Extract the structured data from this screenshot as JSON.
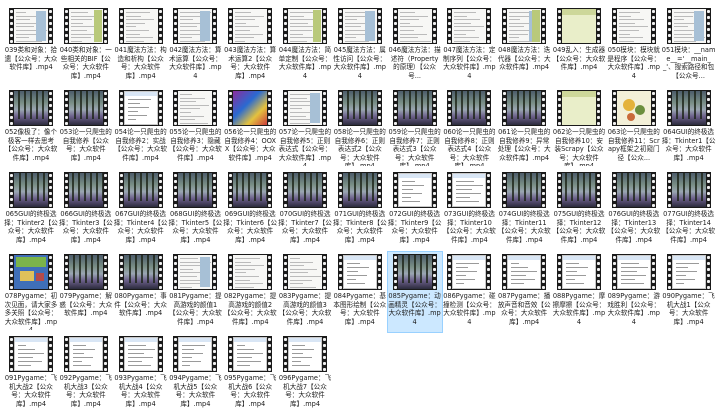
{
  "files": [
    {
      "name": "039类和对象：拾遗【公众号：大众软件库】.mp4",
      "thumb": "doc"
    },
    {
      "name": "040类和对象：一些相关的BIF【公众号：大众软件库】.mp4",
      "thumb": "doc"
    },
    {
      "name": "041魔法方法：构造和析构【公众号：大众软件库】.mp4",
      "thumb": "doc"
    },
    {
      "name": "042魔法方法：算术运算【公众号：大众软件库】.mp4",
      "thumb": "doc"
    },
    {
      "name": "043魔法方法：算术运算2【公众号：大众软件库】.mp4",
      "thumb": "doc"
    },
    {
      "name": "044魔法方法：简单定制【公众号：大众软件库】.mp4",
      "thumb": "doc"
    },
    {
      "name": "045魔法方法：属性访问【公众号：大众软件库】.mp4",
      "thumb": "doc"
    },
    {
      "name": "046魔法方法：描述符（Property的原理）【公众号...",
      "thumb": "doc"
    },
    {
      "name": "047魔法方法：定制序列【公众号：大众软件库】.mp4",
      "thumb": "doc"
    },
    {
      "name": "048魔法方法：迭代器【公众号：大众软件库】.mp4",
      "thumb": "doc"
    },
    {
      "name": "049乱入：生成器【公众号：大众软件库】.mp4",
      "thumb": "green"
    },
    {
      "name": "050模块：模块就是程序【公众号：大众软件库】.mp4",
      "thumb": "doc"
    },
    {
      "name": "051模块：__name__='__main__'、搜索路径和包【公众号...",
      "thumb": "doc"
    },
    {
      "name": "052像极了：像个极客一样去思考【公众号：大众软件库】.mp4",
      "thumb": "forest"
    },
    {
      "name": "053论一只爬虫的自我修养【公众号：大众软件库】.mp4",
      "thumb": "forest"
    },
    {
      "name": "054论一只爬虫的自我修养2：实战【公众号：大众软件库】.mp4",
      "thumb": "win"
    },
    {
      "name": "055论一只爬虫的自我修养3：隐藏【公众号：大众软件库】.mp4",
      "thumb": "doc"
    },
    {
      "name": "056论一只爬虫的自我修养4：OOXX【公众号：大众软件库】.mp4",
      "thumb": "colorful"
    },
    {
      "name": "057论一只爬虫的自我修养5：正则表达式【公众号：大众软件库】.mp4",
      "thumb": "doc"
    },
    {
      "name": "058论一只爬虫的自我修养6：正则表达式2【公众号：大众软件库】.mp4",
      "thumb": "forest"
    },
    {
      "name": "059论一只爬虫的自我修养7：正则表达式3【公众号：大众软件库】.mp4",
      "thumb": "forest"
    },
    {
      "name": "060论一只爬虫的自我修养8：正则表达式4【公众号：大众软件库】.mp4",
      "thumb": "forest"
    },
    {
      "name": "061论一只爬虫的自我修养9：异常处理【公众号：大众软件库】.mp4",
      "thumb": "forest"
    },
    {
      "name": "062论一只爬虫的自我修养10：安装Scrapy【公众号：大众软件库】.mp4",
      "thumb": "green"
    },
    {
      "name": "063论一只爬虫的自我修养11：Scrapy框架之初窥门径【公众...",
      "thumb": "flower"
    },
    {
      "name": "064GUI的终极选择：Tkinter1【公众号：大众软件库】.mp4",
      "thumb": "forest"
    },
    {
      "name": "065GUI的终极选择：Tkinter2【公众号：大众软件库】.mp4",
      "thumb": "forest"
    },
    {
      "name": "066GUI的终极选择：Tkinter3【公众号：大众软件库】.mp4",
      "thumb": "forest"
    },
    {
      "name": "067GUI的终极选择：Tkinter4【公众号：大众软件库】.mp4",
      "thumb": "forest"
    },
    {
      "name": "068GUI的终极选择：Tkinter5【公众号：大众软件库】.mp4",
      "thumb": "forest"
    },
    {
      "name": "069GUI的终极选择：Tkinter6【公众号：大众软件库】.mp4",
      "thumb": "forest"
    },
    {
      "name": "070GUI的终极选择：Tkinter7【公众号：大众软件库】.mp4",
      "thumb": "forest"
    },
    {
      "name": "071GUI的终极选择：Tkinter8【公众号：大众软件库】.mp4",
      "thumb": "forest"
    },
    {
      "name": "072GUI的终极选择：Tkinter9【公众号：大众软件库】.mp4",
      "thumb": "win"
    },
    {
      "name": "073GUI的终极选择：Tkinter10【公众号：大众软件库】.mp4",
      "thumb": "win"
    },
    {
      "name": "074GUI的终极选择：Tkinter11【公众号：大众软件库】.mp4",
      "thumb": "forest"
    },
    {
      "name": "075GUI的终极选择：Tkinter12【公众号：大众软件库】.mp4",
      "thumb": "forest"
    },
    {
      "name": "076GUI的终极选择：Tkinter13【公众号：大众软件库】.mp4",
      "thumb": "forest"
    },
    {
      "name": "077GUI的终极选择：Tkinter14【公众号：大众软件库】.mp4",
      "thumb": "forest"
    },
    {
      "name": "078Pygame：初次见面，请大家多多关照【公众号：大众软件库】.mp4",
      "thumb": "game"
    },
    {
      "name": "079Pygame：解惑【公众号：大众软件库】.mp4",
      "thumb": "forest"
    },
    {
      "name": "080Pygame：事件【公众号：大众软件库】.mp4",
      "thumb": "forest"
    },
    {
      "name": "081Pygame：提高游戏的颜值1【公众号：大众软件库】.mp4",
      "thumb": "doc"
    },
    {
      "name": "082Pygame：提高游戏的颜值2【公众号：大众软件库】.mp4",
      "thumb": "doc"
    },
    {
      "name": "083Pygame：提高游戏的颜值3【公众号：大众软件库】.mp4",
      "thumb": "doc"
    },
    {
      "name": "084Pygame：基本图形绘制【公众号：大众软件库】.mp4",
      "thumb": "win"
    },
    {
      "name": "085Pygame：动画精灵【公众号：大众软件库】.mp4",
      "thumb": "forest",
      "selected": true
    },
    {
      "name": "086Pygame：碰撞检测【公众号：大众软件库】.mp4",
      "thumb": "win"
    },
    {
      "name": "087Pygame：播放声音和音效【公众号：大众软件库】.mp4",
      "thumb": "win"
    },
    {
      "name": "088Pygame：摩擦摩擦【公众号：大众软件库】.mp4",
      "thumb": "win"
    },
    {
      "name": "089Pygame：游戏胜利【公众号：大众软件库】.mp4",
      "thumb": "win"
    },
    {
      "name": "090Pygame：飞机大战1【公众号：大众软件库】.mp4",
      "thumb": "win"
    },
    {
      "name": "091Pygame：飞机大战2【公众号：大众软件库】.mp4",
      "thumb": "win"
    },
    {
      "name": "092Pygame：飞机大战3【公众号：大众软件库】.mp4",
      "thumb": "win"
    },
    {
      "name": "093Pygame：飞机大战4【公众号：大众软件库】.mp4",
      "thumb": "win"
    },
    {
      "name": "094Pygame：飞机大战5【公众号：大众软件库】.mp4",
      "thumb": "win"
    },
    {
      "name": "095Pygame：飞机大战6【公众号：大众软件库】.mp4",
      "thumb": "win"
    },
    {
      "name": "096Pygame：飞机大战7【公众号：大众软件库】.mp4",
      "thumb": "win"
    }
  ],
  "colors": {
    "selection": "#cce8ff",
    "selection_border": "#99d1ff"
  }
}
